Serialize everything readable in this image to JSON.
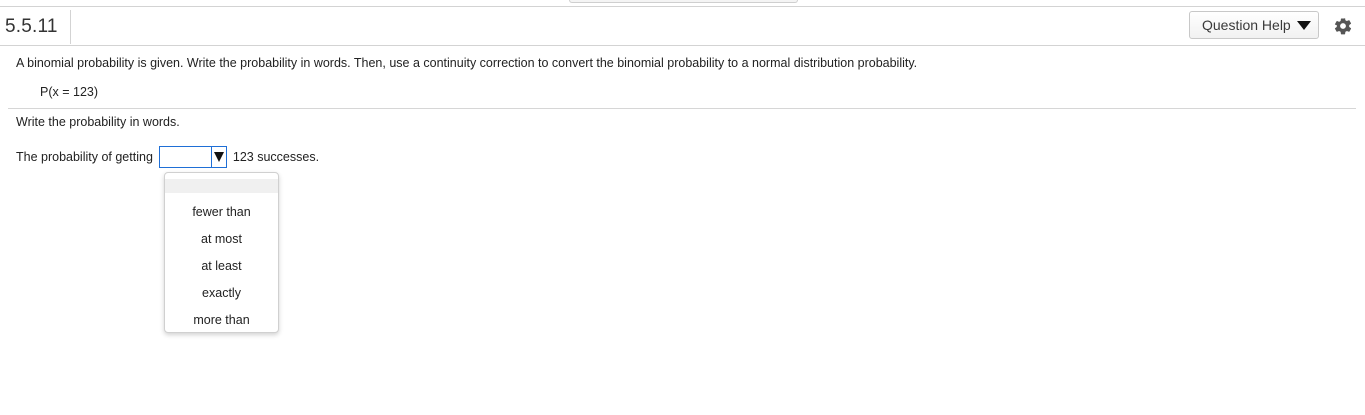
{
  "header": {
    "question_number": "5.5.11",
    "help_button_label": "Question Help",
    "help_icon": "triangle-down-icon",
    "settings_icon": "gear-icon"
  },
  "problem": {
    "prompt": "A binomial probability is given. Write the probability in words. Then, use a continuity correction to convert the binomial probability to a normal distribution probability.",
    "given": "P(x = 123)"
  },
  "answer": {
    "instruction": "Write the probability in words.",
    "prefix": "The probability of getting",
    "selected_value": "",
    "suffix": "123 successes."
  },
  "dropdown": {
    "options": [
      "",
      "fewer than",
      "at most",
      "at least",
      "exactly",
      "more than"
    ]
  },
  "colors": {
    "select_border": "#1f6fd6",
    "divider": "#d3d3d3"
  }
}
